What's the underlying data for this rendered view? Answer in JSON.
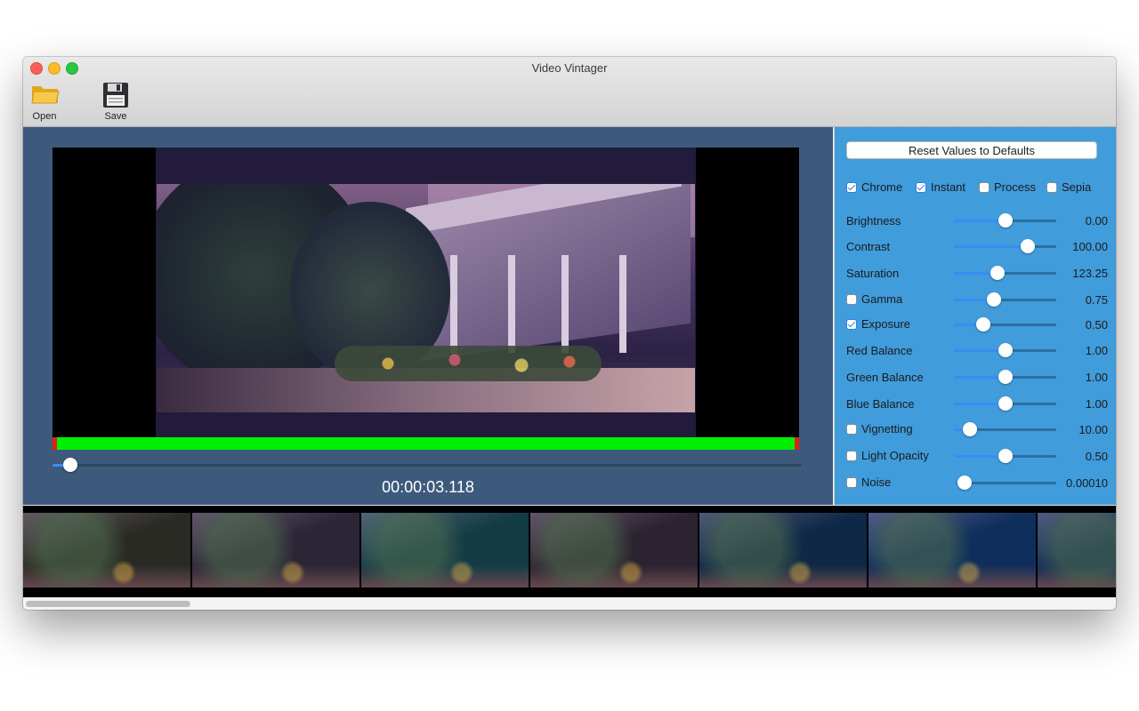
{
  "window": {
    "title": "Video Vintager"
  },
  "toolbar": {
    "open_label": "Open",
    "save_label": "Save"
  },
  "preview": {
    "timecode": "00:00:03.118",
    "scrub_position": 0.024
  },
  "panel": {
    "reset_label": "Reset Values to Defaults",
    "presets": [
      {
        "label": "Chrome",
        "checked": true
      },
      {
        "label": "Instant",
        "checked": true
      },
      {
        "label": "Process",
        "checked": false
      },
      {
        "label": "Sepia",
        "checked": false
      }
    ],
    "adjustments": [
      {
        "label": "Brightness",
        "value": "0.00",
        "level": 0.5,
        "checkbox": false
      },
      {
        "label": "Contrast",
        "value": "100.00",
        "level": 0.72,
        "checkbox": false
      },
      {
        "label": "Saturation",
        "value": "123.25",
        "level": 0.42,
        "checkbox": false
      },
      {
        "label": "Gamma",
        "value": "0.75",
        "level": 0.39,
        "checkbox": true,
        "checked": false
      },
      {
        "label": "Exposure",
        "value": "0.50",
        "level": 0.28,
        "checkbox": true,
        "checked": true
      },
      {
        "label": "Red Balance",
        "value": "1.00",
        "level": 0.5,
        "checkbox": false
      },
      {
        "label": "Green Balance",
        "value": "1.00",
        "level": 0.5,
        "checkbox": false
      },
      {
        "label": "Blue Balance",
        "value": "1.00",
        "level": 0.5,
        "checkbox": false
      },
      {
        "label": "Vignetting",
        "value": "10.00",
        "level": 0.15,
        "checkbox": true,
        "checked": false
      },
      {
        "label": "Light Opacity",
        "value": "0.50",
        "level": 0.5,
        "checkbox": true,
        "checked": false
      },
      {
        "label": "Noise",
        "value": "0.00010",
        "level": 0.1,
        "checkbox": true,
        "checked": false
      }
    ]
  },
  "filmstrip": {
    "tints": [
      "#2a2a25",
      "#2b2536",
      "#123b45",
      "#2c2330",
      "#0e2846",
      "#0f2e5c",
      "#0f2b55"
    ]
  }
}
